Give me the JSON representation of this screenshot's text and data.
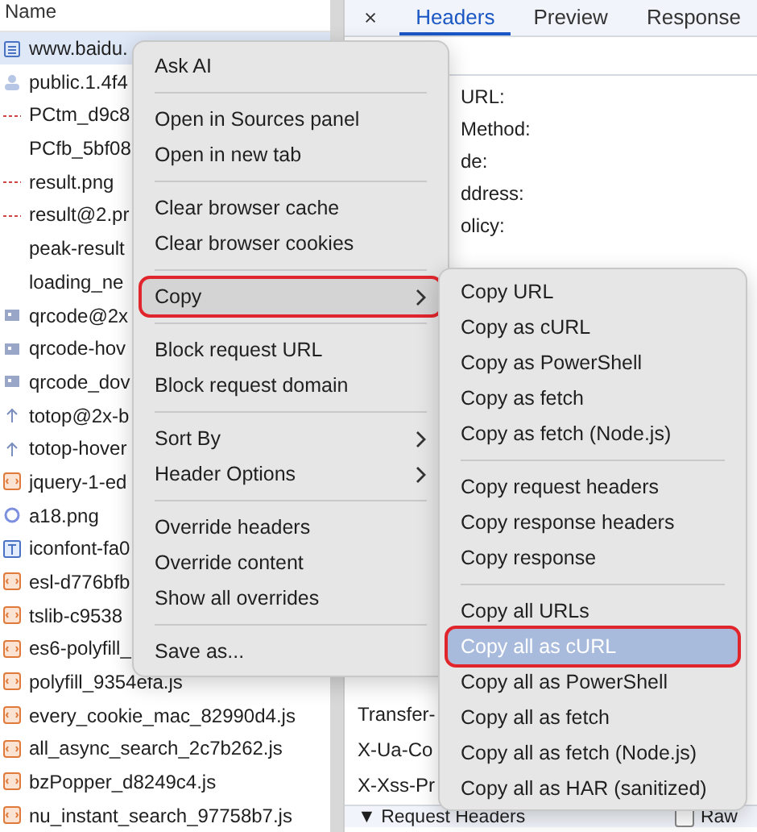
{
  "requests": {
    "column_header": "Name",
    "rows": [
      {
        "name": "www.baidu.",
        "kind": "document",
        "selected": true
      },
      {
        "name": "public.1.4f4",
        "kind": "avatar",
        "selected": false
      },
      {
        "name": "PCtm_d9c8",
        "kind": "dash",
        "selected": false
      },
      {
        "name": "PCfb_5bf08",
        "kind": "none",
        "selected": false
      },
      {
        "name": "result.png",
        "kind": "dash",
        "selected": false
      },
      {
        "name": "result@2.pr",
        "kind": "dash",
        "selected": false
      },
      {
        "name": "peak-result",
        "kind": "none",
        "selected": false
      },
      {
        "name": "loading_ne",
        "kind": "none",
        "selected": false
      },
      {
        "name": "qrcode@2x",
        "kind": "image",
        "selected": false
      },
      {
        "name": "qrcode-hov",
        "kind": "image",
        "selected": false
      },
      {
        "name": "qrcode_dov",
        "kind": "image",
        "selected": false
      },
      {
        "name": "totop@2x-b",
        "kind": "arrow",
        "selected": false
      },
      {
        "name": "totop-hover",
        "kind": "arrow",
        "selected": false
      },
      {
        "name": "jquery-1-ed",
        "kind": "script",
        "selected": false
      },
      {
        "name": "a18.png",
        "kind": "ring",
        "selected": false
      },
      {
        "name": "iconfont-fa0",
        "kind": "font",
        "selected": false
      },
      {
        "name": "esl-d776bfb",
        "kind": "script",
        "selected": false
      },
      {
        "name": "tslib-c9538",
        "kind": "script",
        "selected": false
      },
      {
        "name": "es6-polyfill_",
        "kind": "script",
        "selected": false
      },
      {
        "name": "polyfill_9354efa.js",
        "kind": "script",
        "selected": false
      },
      {
        "name": "every_cookie_mac_82990d4.js",
        "kind": "script",
        "selected": false
      },
      {
        "name": "all_async_search_2c7b262.js",
        "kind": "script",
        "selected": false
      },
      {
        "name": "bzPopper_d8249c4.js",
        "kind": "script",
        "selected": false
      },
      {
        "name": "nu_instant_search_97758b7.js",
        "kind": "script",
        "selected": false
      }
    ]
  },
  "details": {
    "tabs": [
      {
        "label": "Headers",
        "selected": true
      },
      {
        "label": "Preview",
        "selected": false
      },
      {
        "label": "Response",
        "selected": false
      }
    ],
    "general": [
      "URL:",
      "Method:",
      "de:",
      "ddress:",
      "olicy:"
    ],
    "header_rows": [
      "Transfer-",
      "X-Ua-Co",
      "X-Xss-Pr"
    ],
    "section": "▼ Request Headers",
    "raw_checkbox": {
      "label": "Raw",
      "checked": false
    }
  },
  "context_menu": {
    "items": [
      {
        "kind": "item",
        "label": "Ask AI",
        "submenu": false,
        "selected": false,
        "outlined": false
      },
      {
        "kind": "separator"
      },
      {
        "kind": "item",
        "label": "Open in Sources panel",
        "submenu": false,
        "selected": false,
        "outlined": false
      },
      {
        "kind": "item",
        "label": "Open in new tab",
        "submenu": false,
        "selected": false,
        "outlined": false
      },
      {
        "kind": "separator"
      },
      {
        "kind": "item",
        "label": "Clear browser cache",
        "submenu": false,
        "selected": false,
        "outlined": false
      },
      {
        "kind": "item",
        "label": "Clear browser cookies",
        "submenu": false,
        "selected": false,
        "outlined": false
      },
      {
        "kind": "separator"
      },
      {
        "kind": "item",
        "label": "Copy",
        "submenu": true,
        "selected": true,
        "outlined": true
      },
      {
        "kind": "separator"
      },
      {
        "kind": "item",
        "label": "Block request URL",
        "submenu": false,
        "selected": false,
        "outlined": false
      },
      {
        "kind": "item",
        "label": "Block request domain",
        "submenu": false,
        "selected": false,
        "outlined": false
      },
      {
        "kind": "separator"
      },
      {
        "kind": "item",
        "label": "Sort By",
        "submenu": true,
        "selected": false,
        "outlined": false
      },
      {
        "kind": "item",
        "label": "Header Options",
        "submenu": true,
        "selected": false,
        "outlined": false
      },
      {
        "kind": "separator"
      },
      {
        "kind": "item",
        "label": "Override headers",
        "submenu": false,
        "selected": false,
        "outlined": false
      },
      {
        "kind": "item",
        "label": "Override content",
        "submenu": false,
        "selected": false,
        "outlined": false
      },
      {
        "kind": "item",
        "label": "Show all overrides",
        "submenu": false,
        "selected": false,
        "outlined": false
      },
      {
        "kind": "separator"
      },
      {
        "kind": "item",
        "label": "Save as...",
        "submenu": false,
        "selected": false,
        "outlined": false
      }
    ]
  },
  "copy_submenu": {
    "items": [
      {
        "kind": "item",
        "label": "Copy URL",
        "selected": false,
        "outlined": false
      },
      {
        "kind": "item",
        "label": "Copy as cURL",
        "selected": false,
        "outlined": false
      },
      {
        "kind": "item",
        "label": "Copy as PowerShell",
        "selected": false,
        "outlined": false
      },
      {
        "kind": "item",
        "label": "Copy as fetch",
        "selected": false,
        "outlined": false
      },
      {
        "kind": "item",
        "label": "Copy as fetch (Node.js)",
        "selected": false,
        "outlined": false
      },
      {
        "kind": "separator"
      },
      {
        "kind": "item",
        "label": "Copy request headers",
        "selected": false,
        "outlined": false
      },
      {
        "kind": "item",
        "label": "Copy response headers",
        "selected": false,
        "outlined": false
      },
      {
        "kind": "item",
        "label": "Copy response",
        "selected": false,
        "outlined": false
      },
      {
        "kind": "separator"
      },
      {
        "kind": "item",
        "label": "Copy all URLs",
        "selected": false,
        "outlined": false
      },
      {
        "kind": "item",
        "label": "Copy all as cURL",
        "selected": true,
        "outlined": true
      },
      {
        "kind": "item",
        "label": "Copy all as PowerShell",
        "selected": false,
        "outlined": false
      },
      {
        "kind": "item",
        "label": "Copy all as fetch",
        "selected": false,
        "outlined": false
      },
      {
        "kind": "item",
        "label": "Copy all as fetch (Node.js)",
        "selected": false,
        "outlined": false
      },
      {
        "kind": "item",
        "label": "Copy all as HAR (sanitized)",
        "selected": false,
        "outlined": false
      }
    ]
  }
}
